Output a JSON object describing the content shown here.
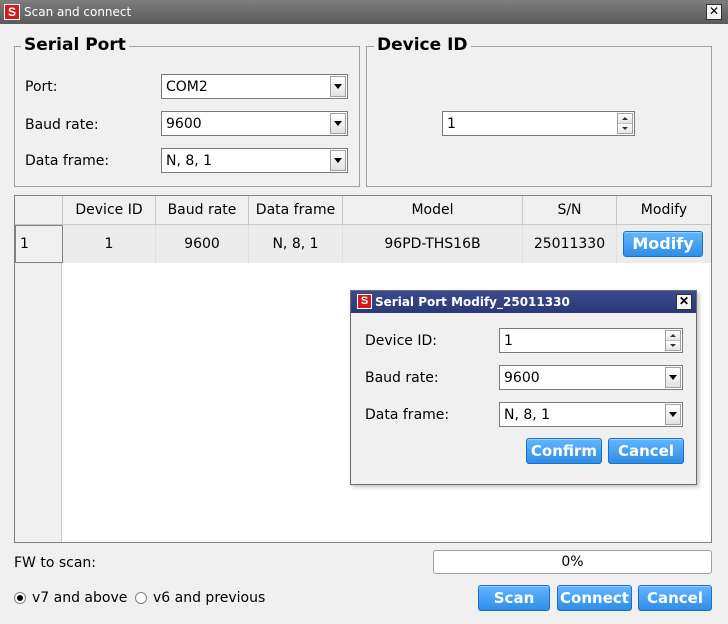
{
  "window": {
    "title": "Scan and connect"
  },
  "serial_port": {
    "legend": "Serial Port",
    "port_label": "Port:",
    "port_value": "COM2",
    "baud_label": "Baud rate:",
    "baud_value": "9600",
    "frame_label": "Data frame:",
    "frame_value": "N, 8, 1"
  },
  "device_id": {
    "legend": "Device ID",
    "value": "1"
  },
  "table": {
    "headers": [
      "Device ID",
      "Baud rate",
      "Data frame",
      "Model",
      "S/N",
      "Modify"
    ],
    "rows": [
      {
        "row_no": "1",
        "device_id": "1",
        "baud_rate": "9600",
        "data_frame": "N, 8, 1",
        "model": "96PD-THS16B",
        "sn": "25011330",
        "modify_label": "Modify"
      }
    ]
  },
  "modal": {
    "title": "Serial Port Modify_25011330",
    "device_id_label": "Device ID:",
    "device_id_value": "1",
    "baud_label": "Baud rate:",
    "baud_value": "9600",
    "frame_label": "Data frame:",
    "frame_value": "N, 8, 1",
    "confirm_label": "Confirm",
    "cancel_label": "Cancel"
  },
  "footer": {
    "fw_label": "FW to scan:",
    "progress_text": "0%",
    "progress_fraction": 0,
    "radio_v7": "v7 and above",
    "radio_v6": "v6 and previous",
    "radio_selected": "v7",
    "scan_label": "Scan",
    "connect_label": "Connect",
    "cancel_label": "Cancel"
  },
  "colors": {
    "accent": "#3a97f0",
    "title_bar": "#6b6b6b",
    "modal_title_bar": "#2f3d7f",
    "logo": "#d21c1c"
  },
  "icons": {
    "logo": "app-logo-s",
    "close": "close-icon"
  },
  "logo_text": "S"
}
